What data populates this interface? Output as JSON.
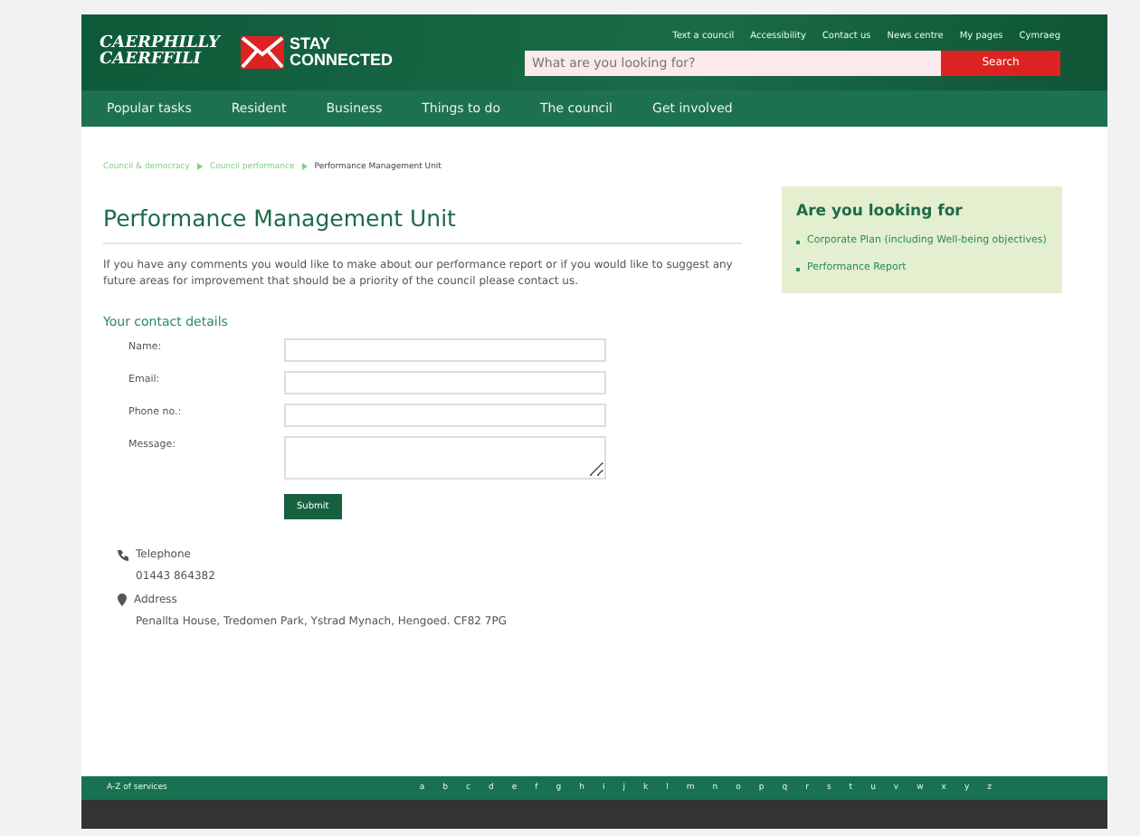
{
  "header": {
    "logo": "CAERPHILLY CAERFFILI",
    "stay_connected": [
      "STAY",
      "CONNECTED"
    ],
    "top_links": [
      "Text a council",
      "Accessibility",
      "Contact us",
      "News centre",
      "My pages",
      "Cymraeg"
    ],
    "search": {
      "placeholder": "What are you looking for?",
      "button": "Search"
    }
  },
  "nav": [
    "Popular tasks",
    "Resident",
    "Business",
    "Things to do",
    "The council",
    "Get involved"
  ],
  "breadcrumb": [
    "Council & democracy",
    "Council performance",
    "Performance Management Unit"
  ],
  "title": "Performance Management Unit",
  "intro": "If you have any comments you would like to make about our performance report or if you would like to suggest any future areas for improvement that should be a priority of the council please contact us.",
  "form": {
    "legend": "Your contact details",
    "fields": [
      {
        "label": "Name:",
        "kind": "text"
      },
      {
        "label": "Email:",
        "kind": "text"
      },
      {
        "label": "Phone no.:",
        "kind": "text"
      },
      {
        "label": "Message:",
        "kind": "textarea"
      }
    ],
    "submit": "Submit"
  },
  "contact": [
    {
      "kind": "phone",
      "label": "Telephone",
      "value": "01443 864382"
    },
    {
      "kind": "address",
      "label": "Address",
      "value": "Penallta House, Tredomen Park, Ystrad Mynach, Hengoed. CF82 7PG"
    }
  ],
  "sidebar": {
    "title": "Are you looking for",
    "links": [
      "Corporate Plan (including Well-being objectives)",
      "Performance Report"
    ]
  },
  "footer": {
    "az_label": "A-Z of services",
    "letters": [
      "a",
      "b",
      "c",
      "d",
      "e",
      "f",
      "g",
      "h",
      "i",
      "j",
      "k",
      "l",
      "m",
      "n",
      "o",
      "p",
      "q",
      "r",
      "s",
      "t",
      "u",
      "v",
      "w",
      "x",
      "y",
      "z"
    ]
  }
}
